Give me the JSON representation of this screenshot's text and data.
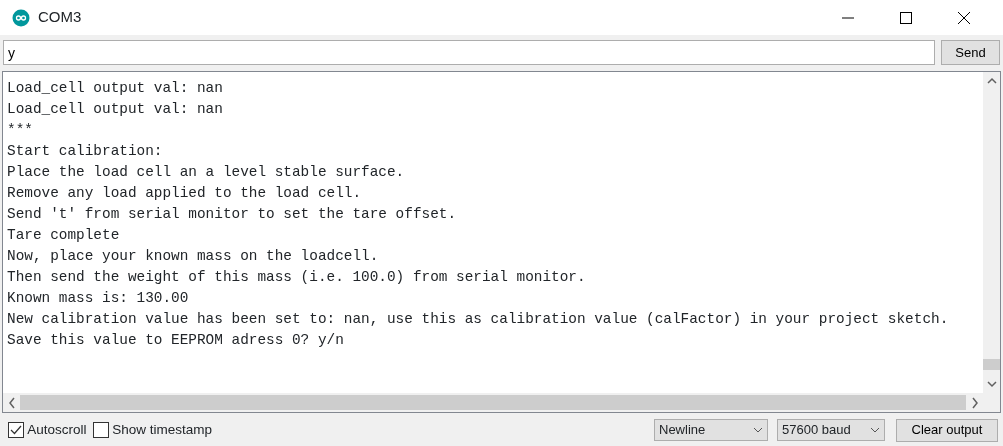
{
  "window": {
    "title": "COM3"
  },
  "input": {
    "value": "y"
  },
  "send_button": "Send",
  "output_lines": [
    "Load_cell output val: nan",
    "Load_cell output val: nan",
    "***",
    "Start calibration:",
    "Place the load cell an a level stable surface.",
    "Remove any load applied to the load cell.",
    "Send 't' from serial monitor to set the tare offset.",
    "Tare complete",
    "Now, place your known mass on the loadcell.",
    "Then send the weight of this mass (i.e. 100.0) from serial monitor.",
    "Known mass is: 130.00",
    "New calibration value has been set to: nan, use this as calibration value (calFactor) in your project sketch.",
    "Save this value to EEPROM adress 0? y/n"
  ],
  "options": [
    {
      "label": "Autoscroll",
      "checked": true
    },
    {
      "label": "Show timestamp",
      "checked": false
    }
  ],
  "line_ending": "Newline",
  "baud_rate": "57600 baud",
  "clear_button": "Clear output"
}
